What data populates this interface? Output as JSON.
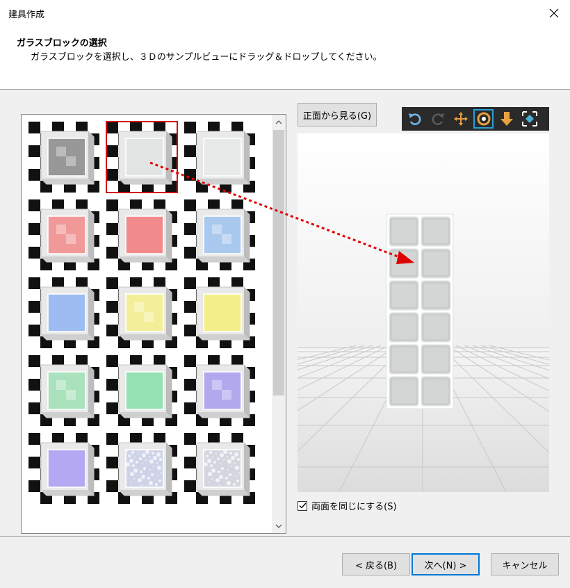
{
  "window": {
    "title": "建具作成"
  },
  "header": {
    "title": "ガラスブロックの選択",
    "subtitle": "ガラスブロックを選択し、３Ｄのサンプルビューにドラッグ＆ドロップしてください。"
  },
  "thumbnails": [
    {
      "name": "glass-block-clear-pattern",
      "tint": "#8a8a8a",
      "pattern": "checker",
      "selected": false
    },
    {
      "name": "glass-block-clear",
      "tint": "#dfe4e2",
      "pattern": "faint",
      "selected": true
    },
    {
      "name": "glass-block-frosted",
      "tint": "#e6eae8",
      "pattern": "plain",
      "selected": false
    },
    {
      "name": "glass-block-red-pattern",
      "tint": "#f28a8a",
      "pattern": "checker",
      "selected": false
    },
    {
      "name": "glass-block-red",
      "tint": "#f27a7a",
      "pattern": "plain",
      "selected": false
    },
    {
      "name": "glass-block-blue-pattern",
      "tint": "#9ec3ee",
      "pattern": "checker",
      "selected": false
    },
    {
      "name": "glass-block-blue",
      "tint": "#8fb4f2",
      "pattern": "plain",
      "selected": false
    },
    {
      "name": "glass-block-yellow-pattern",
      "tint": "#f4ef8a",
      "pattern": "checker",
      "selected": false
    },
    {
      "name": "glass-block-yellow",
      "tint": "#f6f07a",
      "pattern": "plain",
      "selected": false
    },
    {
      "name": "glass-block-green-pattern",
      "tint": "#9ee0b4",
      "pattern": "checker",
      "selected": false
    },
    {
      "name": "glass-block-green",
      "tint": "#86e0a8",
      "pattern": "plain",
      "selected": false
    },
    {
      "name": "glass-block-purple-pattern",
      "tint": "#a79cee",
      "pattern": "checker",
      "selected": false
    },
    {
      "name": "glass-block-lavender",
      "tint": "#a99cf2",
      "pattern": "plain",
      "selected": false
    },
    {
      "name": "glass-block-textured",
      "tint": "#c9cfe6",
      "pattern": "texture",
      "selected": false
    },
    {
      "name": "glass-block-textured-2",
      "tint": "#cfd2dc",
      "pattern": "texture",
      "selected": false
    }
  ],
  "view_controls": {
    "front_view_label": "正面から見る(G)",
    "tools": [
      {
        "icon": "undo-icon",
        "color": "#6fb6e8",
        "active": false
      },
      {
        "icon": "redo-icon",
        "color": "#5a5a5a",
        "active": false
      },
      {
        "icon": "move-icon",
        "color": "#e8a040",
        "active": false
      },
      {
        "icon": "rotate-icon",
        "color": "#e8a040",
        "active": true
      },
      {
        "icon": "down-arrow-icon",
        "color": "#e8a040",
        "active": false
      },
      {
        "icon": "fit-view-icon",
        "color": "#4ab0d8",
        "active": false
      }
    ]
  },
  "preview": {
    "rows": 6,
    "cols": 2
  },
  "options": {
    "both_sides_label": "両面を同じにする(S)",
    "both_sides_checked": true
  },
  "footer": {
    "back_label": "< 戻る(B)",
    "next_label": "次へ(N) >",
    "cancel_label": "キャンセル"
  }
}
